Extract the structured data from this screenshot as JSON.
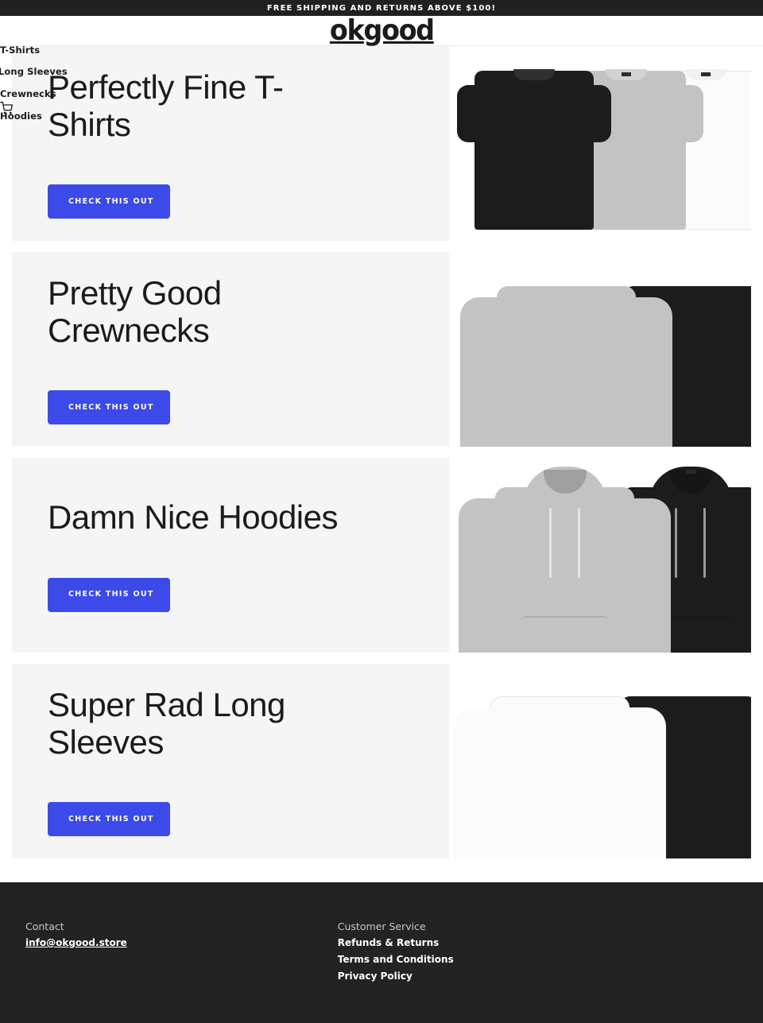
{
  "announcement": {
    "text": "FREE SHIPPING AND RETURNS ABOVE $100!",
    "background": "#212121"
  },
  "header": {
    "logo": "okgood",
    "cart_icon": "shopping-cart-icon"
  },
  "nav": {
    "items": [
      {
        "label": "T-Shirts"
      },
      {
        "label": "Long Sleeves"
      },
      {
        "label": "Crewnecks"
      },
      {
        "label": "Hoodies"
      }
    ]
  },
  "theme": {
    "accent": "#3b4ae8",
    "card_bg": "#f5f5f5",
    "footer_bg": "#232323",
    "text": "#1b1b1b"
  },
  "sections": [
    {
      "title": "Perfectly Fine T-Shirts",
      "cta": "CHECK THIS OUT",
      "product": "t-shirts",
      "colors": [
        "black",
        "grey",
        "white"
      ]
    },
    {
      "title": "Pretty Good Crewnecks",
      "cta": "CHECK THIS OUT",
      "product": "crewnecks",
      "colors": [
        "grey",
        "black"
      ]
    },
    {
      "title": "Damn Nice Hoodies",
      "cta": "CHECK THIS OUT",
      "product": "hoodies",
      "colors": [
        "grey",
        "black"
      ]
    },
    {
      "title": "Super Rad Long Sleeves",
      "cta": "CHECK THIS OUT",
      "product": "long-sleeves",
      "colors": [
        "white",
        "black"
      ]
    }
  ],
  "footer": {
    "contact_heading": "Contact",
    "contact_email": "info@okgood.store",
    "service_heading": "Customer Service",
    "service_links": [
      {
        "label": "Refunds & Returns"
      },
      {
        "label": "Terms and Conditions"
      },
      {
        "label": "Privacy Policy"
      }
    ]
  }
}
